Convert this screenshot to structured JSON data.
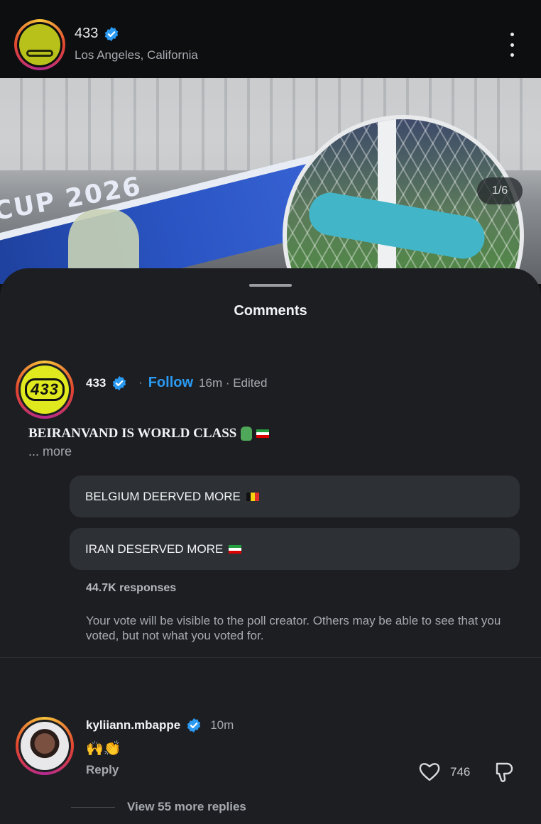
{
  "post_header": {
    "username": "433",
    "location": "Los Angeles, California",
    "avatar_icon": "433-logo-icon",
    "menu_icon": "more-vertical-icon"
  },
  "media": {
    "counter": "1/6",
    "banner_text": "CUP 2026"
  },
  "sheet": {
    "title": "Comments"
  },
  "caption_comment": {
    "username": "433",
    "follow_label": "Follow",
    "meta": "16m · Edited",
    "text": "BEIRANVAND IS WORLD CLASS",
    "more_label": "... more",
    "poll": {
      "options": [
        {
          "label": "BELGIUM DEERVED MORE",
          "flag": "belgium-flag-icon"
        },
        {
          "label": "IRAN DESERVED MORE",
          "flag": "iran-flag-icon"
        }
      ],
      "responses": "44.7K responses",
      "notice": "Your vote will be visible to the poll creator. Others may be able to see that you voted, but not what you voted for."
    }
  },
  "comment": {
    "username": "kyliiann.mbappe",
    "time": "10m",
    "text": "🙌👏",
    "reply_label": "Reply",
    "like_count": "746",
    "view_replies": "View 55 more replies"
  },
  "colors": {
    "accent_blue": "#2b9af3",
    "sheet_bg": "#1c1e22",
    "poll_option_bg": "#2d3035"
  }
}
